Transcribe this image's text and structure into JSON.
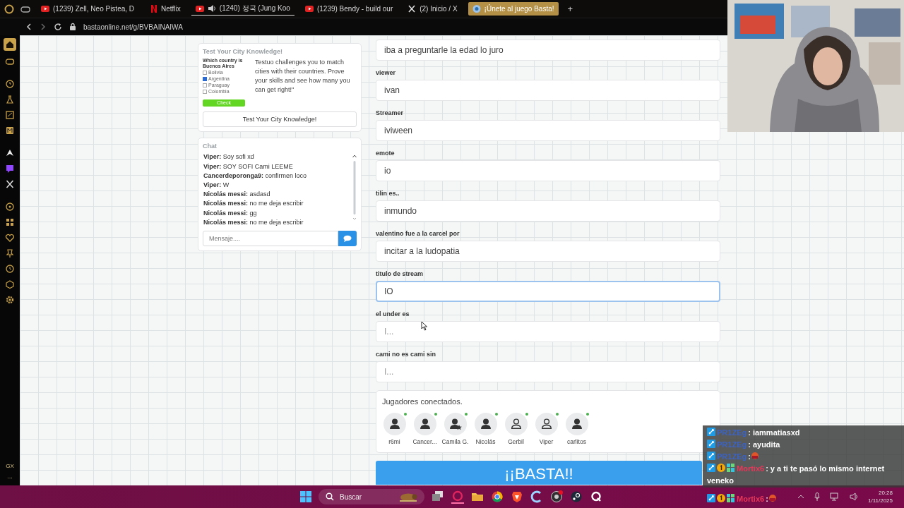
{
  "browser": {
    "tabs": [
      {
        "kind": "video",
        "title": "(1239) Zell, Neo Pistea, D",
        "selected": false,
        "audio": false
      },
      {
        "kind": "film",
        "title": "Netflix",
        "selected": false,
        "audio": false
      },
      {
        "kind": "video",
        "title": "(1240) 정국 (Jung Koo",
        "selected": false,
        "audio": true
      },
      {
        "kind": "video",
        "title": "(1239) Bendy - build our",
        "selected": false,
        "audio": false
      },
      {
        "kind": "social",
        "title": "(2) Inicio / X",
        "selected": false,
        "audio": false
      },
      {
        "kind": "game",
        "title": "¡Únete al juego Basta!",
        "selected": true,
        "audio": false
      }
    ],
    "new_tab": "+",
    "url": "bastaonline.net/g/BVBAINAIWA",
    "sidebar_footer": [
      "GX",
      "···"
    ]
  },
  "ad": {
    "title": "Test Your City Knowledge!",
    "quiz": {
      "question": "Which country is Buenos Aires",
      "options": [
        {
          "label": "Bolivia",
          "checked": false
        },
        {
          "label": "Argentina",
          "checked": true
        },
        {
          "label": "Paraguay",
          "checked": false
        },
        {
          "label": "Colombia",
          "checked": false
        }
      ],
      "button": "Check"
    },
    "description": "Testuo challenges you to match cities with their countries. Prove your skills and see how many you can get right!\"",
    "button": "Test Your City Knowledge!"
  },
  "chat": {
    "title": "Chat",
    "messages": [
      {
        "user": "Viper:",
        "text": "Soy sofi xd"
      },
      {
        "user": "Viper:",
        "text": "SOY SOFI Cami LEEME"
      },
      {
        "user": "Cancerdeporonga9:",
        "text": "confirmen loco"
      },
      {
        "user": "Viper:",
        "text": "W"
      },
      {
        "user": "Nicolás messi:",
        "text": "asdasd"
      },
      {
        "user": "Nicolás messi:",
        "text": "no me deja escribir"
      },
      {
        "user": "Nicolás messi:",
        "text": "gg"
      },
      {
        "user": "Nicolás messi:",
        "text": "no me deja escribir"
      }
    ],
    "input": {
      "placeholder": "Mensaje...."
    }
  },
  "form": {
    "fields": [
      {
        "value": "iba a preguntarle la edad lo juro",
        "focused": false
      },
      {
        "label": "viewer",
        "value": "ivan",
        "focused": false
      },
      {
        "label": "Streamer",
        "value": "iviween",
        "focused": false
      },
      {
        "label": "emote",
        "value": "io",
        "focused": false
      },
      {
        "label": "tilin es..",
        "value": "inmundo",
        "focused": false
      },
      {
        "label": "valentino fue a la carcel por",
        "value": "incitar a la ludopatia",
        "focused": false
      },
      {
        "label": "titulo de stream",
        "value": "IO",
        "focused": true
      },
      {
        "label": "el under es",
        "placeholder": "I...",
        "focused": false
      },
      {
        "label": "cami no es cami sin",
        "placeholder": "I...",
        "focused": false
      }
    ]
  },
  "players": {
    "title": "Jugadores conectados.",
    "list": [
      {
        "name": "r6mi",
        "kind": "user",
        "online": true
      },
      {
        "name": "Cancer...",
        "kind": "user",
        "online": true
      },
      {
        "name": "Camila G.",
        "kind": "host",
        "online": true
      },
      {
        "name": "Nicolás",
        "kind": "user",
        "online": true
      },
      {
        "name": "Gerbil",
        "kind": "guest",
        "online": true
      },
      {
        "name": "Viper",
        "kind": "guest",
        "online": true
      },
      {
        "name": "carlitos",
        "kind": "user",
        "online": true
      }
    ]
  },
  "basta_button": "¡¡BASTA!!",
  "stream_chat": [
    {
      "user": "PR1ZEg",
      "color": "#3a63c8",
      "moderator": true,
      "subscriber": false,
      "game_badge": false,
      "text": ": iammatiasxd"
    },
    {
      "user": "PR1ZEg",
      "color": "#3a63c8",
      "moderator": true,
      "subscriber": false,
      "game_badge": false,
      "text": ": ayudita"
    },
    {
      "user": "PR1ZEg",
      "color": "#3a63c8",
      "moderator": true,
      "subscriber": false,
      "game_badge": false,
      "text": ":",
      "emote": true
    },
    {
      "user": "Mortix6",
      "color": "#e8385a",
      "moderator": true,
      "subscriber": true,
      "game_badge": true,
      "text": ": y a ti te pasó lo mismo internet",
      "continuation": "veneko"
    },
    {
      "user": "Mortix6",
      "color": "#e8385a",
      "moderator": true,
      "subscriber": true,
      "game_badge": true,
      "text": ":",
      "emote": true
    }
  ],
  "taskbar": {
    "search": {
      "placeholder": "Buscar"
    },
    "time": "20:28",
    "date": "1/11/2025"
  }
}
